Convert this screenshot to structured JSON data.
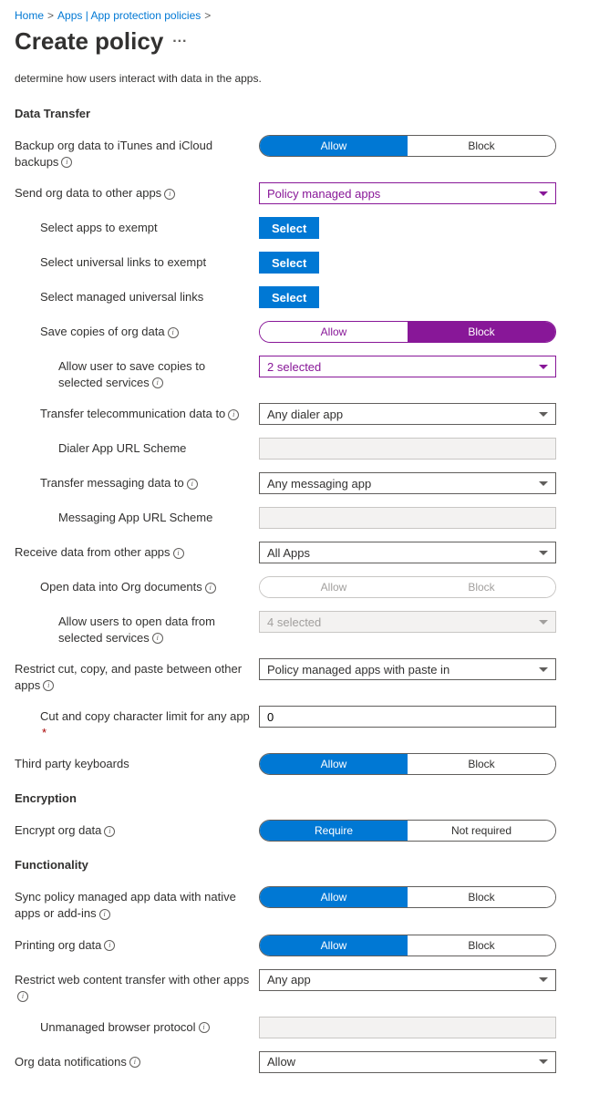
{
  "breadcrumb": {
    "home": "Home",
    "apps": "Apps | App protection policies"
  },
  "page_title": "Create policy",
  "description": "determine how users interact with data in the apps.",
  "sections": {
    "data_transfer": "Data Transfer",
    "encryption": "Encryption",
    "functionality": "Functionality"
  },
  "labels": {
    "backup": "Backup org data to iTunes and iCloud backups",
    "send_other": "Send org data to other apps",
    "select_exempt": "Select apps to exempt",
    "select_universal": "Select universal links to exempt",
    "select_managed_universal": "Select managed universal links",
    "save_copies": "Save copies of org data",
    "allow_save_services": "Allow user to save copies to selected services",
    "transfer_telecom": "Transfer telecommunication data to",
    "dialer_scheme": "Dialer App URL Scheme",
    "transfer_messaging": "Transfer messaging data to",
    "messaging_scheme": "Messaging App URL Scheme",
    "receive_other": "Receive data from other apps",
    "open_into_org": "Open data into Org documents",
    "allow_open_services": "Allow users to open data from selected services",
    "restrict_cut": "Restrict cut, copy, and paste between other apps",
    "cut_copy_limit": "Cut and copy character limit for any app",
    "third_party_kb": "Third party keyboards",
    "encrypt_org": "Encrypt org data",
    "sync_native": "Sync policy managed app data with native apps or add-ins",
    "printing": "Printing org data",
    "restrict_web": "Restrict web content transfer with other apps",
    "unmanaged_browser": "Unmanaged browser protocol",
    "org_notifications": "Org data notifications"
  },
  "values": {
    "send_other": "Policy managed apps",
    "allow_save_services": "2 selected",
    "transfer_telecom": "Any dialer app",
    "transfer_messaging": "Any messaging app",
    "receive_other": "All Apps",
    "allow_open_services": "4 selected",
    "restrict_cut": "Policy managed apps with paste in",
    "cut_copy_limit": "0",
    "restrict_web": "Any app",
    "org_notifications": "Allow"
  },
  "buttons": {
    "select": "Select"
  },
  "toggle_options": {
    "allow": "Allow",
    "block": "Block",
    "require": "Require",
    "not_required": "Not required"
  }
}
